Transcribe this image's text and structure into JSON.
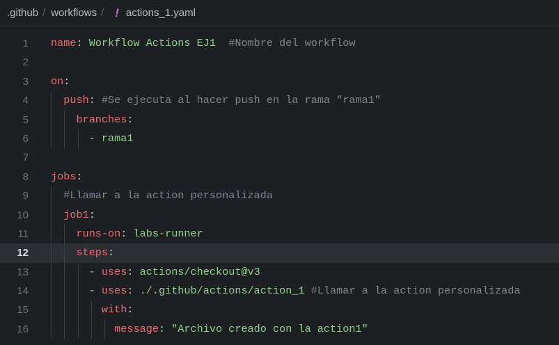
{
  "breadcrumb": {
    "items": [
      ".github",
      "workflows",
      "actions_1.yaml"
    ],
    "separator": "/",
    "file_icon_glyph": "!"
  },
  "editor": {
    "active_line": "12",
    "lines": [
      {
        "n": "1",
        "tokens": [
          {
            "t": "name",
            "c": "key"
          },
          {
            "t": ": ",
            "c": "pl"
          },
          {
            "t": "Workflow Actions EJ1",
            "c": "str"
          },
          {
            "t": "  ",
            "c": "pl"
          },
          {
            "t": "#Nombre del workflow",
            "c": "cm"
          }
        ]
      },
      {
        "n": "2",
        "tokens": []
      },
      {
        "n": "3",
        "tokens": [
          {
            "t": "on",
            "c": "key"
          },
          {
            "t": ":",
            "c": "pl"
          }
        ]
      },
      {
        "n": "4",
        "tokens": [
          {
            "t": "  ",
            "c": "pl"
          },
          {
            "t": "push",
            "c": "key"
          },
          {
            "t": ": ",
            "c": "pl"
          },
          {
            "t": "#Se ejecuta al hacer push en la rama \"rama1\"",
            "c": "cm"
          }
        ]
      },
      {
        "n": "5",
        "tokens": [
          {
            "t": "    ",
            "c": "pl"
          },
          {
            "t": "branches",
            "c": "key"
          },
          {
            "t": ":",
            "c": "pl"
          }
        ]
      },
      {
        "n": "6",
        "tokens": [
          {
            "t": "      - ",
            "c": "pl"
          },
          {
            "t": "rama1",
            "c": "str"
          }
        ]
      },
      {
        "n": "7",
        "tokens": []
      },
      {
        "n": "8",
        "tokens": [
          {
            "t": "jobs",
            "c": "key"
          },
          {
            "t": ":",
            "c": "pl"
          }
        ]
      },
      {
        "n": "9",
        "tokens": [
          {
            "t": "  ",
            "c": "pl"
          },
          {
            "t": "#Llamar a la action personalizada",
            "c": "cm"
          }
        ]
      },
      {
        "n": "10",
        "tokens": [
          {
            "t": "  ",
            "c": "pl"
          },
          {
            "t": "job1",
            "c": "key"
          },
          {
            "t": ":",
            "c": "pl"
          }
        ]
      },
      {
        "n": "11",
        "tokens": [
          {
            "t": "    ",
            "c": "pl"
          },
          {
            "t": "runs-on",
            "c": "key"
          },
          {
            "t": ": ",
            "c": "pl"
          },
          {
            "t": "labs-runner",
            "c": "str"
          }
        ]
      },
      {
        "n": "12",
        "tokens": [
          {
            "t": "    ",
            "c": "pl"
          },
          {
            "t": "steps",
            "c": "key"
          },
          {
            "t": ":",
            "c": "pl"
          }
        ]
      },
      {
        "n": "13",
        "tokens": [
          {
            "t": "      - ",
            "c": "pl"
          },
          {
            "t": "uses",
            "c": "key"
          },
          {
            "t": ": ",
            "c": "pl"
          },
          {
            "t": "actions/checkout@v3",
            "c": "str"
          }
        ]
      },
      {
        "n": "14",
        "tokens": [
          {
            "t": "      - ",
            "c": "pl"
          },
          {
            "t": "uses",
            "c": "key"
          },
          {
            "t": ": ",
            "c": "pl"
          },
          {
            "t": "./.github/actions/action_1",
            "c": "str"
          },
          {
            "t": " ",
            "c": "pl"
          },
          {
            "t": "#Llamar a la action personalizada",
            "c": "cm"
          }
        ]
      },
      {
        "n": "15",
        "tokens": [
          {
            "t": "        ",
            "c": "pl"
          },
          {
            "t": "with",
            "c": "key"
          },
          {
            "t": ":",
            "c": "pl"
          }
        ]
      },
      {
        "n": "16",
        "tokens": [
          {
            "t": "          ",
            "c": "pl"
          },
          {
            "t": "message",
            "c": "key"
          },
          {
            "t": ": ",
            "c": "pl"
          },
          {
            "t": "\"Archivo creado con la action1\"",
            "c": "str"
          }
        ]
      }
    ]
  }
}
